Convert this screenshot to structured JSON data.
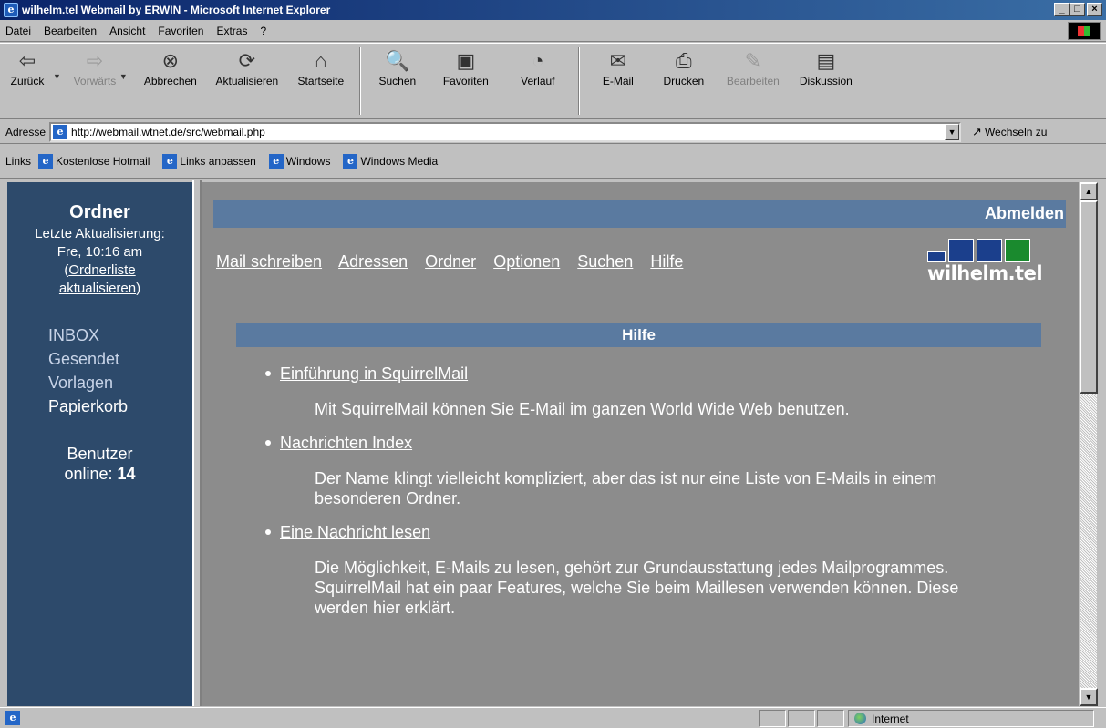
{
  "window": {
    "title": "wilhelm.tel Webmail by ERWIN - Microsoft Internet Explorer",
    "buttons": [
      "_",
      "□",
      "×"
    ]
  },
  "menu": [
    "Datei",
    "Bearbeiten",
    "Ansicht",
    "Favoriten",
    "Extras",
    "?"
  ],
  "toolbar": {
    "back": "Zurück",
    "forward": "Vorwärts",
    "stop": "Abbrechen",
    "refresh": "Aktualisieren",
    "home": "Startseite",
    "search": "Suchen",
    "favorites": "Favoriten",
    "history": "Verlauf",
    "mail": "E-Mail",
    "print": "Drucken",
    "edit": "Bearbeiten",
    "discuss": "Diskussion"
  },
  "address": {
    "label": "Adresse",
    "url": "http://webmail.wtnet.de/src/webmail.php",
    "go": "Wechseln zu"
  },
  "links": {
    "label": "Links",
    "items": [
      "Kostenlose Hotmail",
      "Links anpassen",
      "Windows",
      "Windows Media"
    ]
  },
  "left": {
    "title": "Ordner",
    "updated_label": "Letzte Aktualisierung:",
    "updated_time": "Fre, 10:16 am",
    "refresh_open": "(",
    "refresh_line1": "Ordnerliste",
    "refresh_line2": "aktualisieren",
    "refresh_close": ")",
    "folders": [
      "INBOX",
      "Gesendet",
      "Vorlagen",
      "Papierkorb"
    ],
    "users_label": "Benutzer",
    "users_online_label": "online:",
    "users_online": "14"
  },
  "right": {
    "logout": "Abmelden",
    "nav": [
      "Mail schreiben",
      "Adressen",
      "Ordner",
      "Optionen",
      "Suchen",
      "Hilfe"
    ],
    "logo_text": "wilhelm.tel",
    "help_title": "Hilfe",
    "help_items": [
      {
        "title": "Einführung in SquirrelMail",
        "desc": "Mit SquirrelMail können Sie E-Mail im ganzen World Wide Web benutzen."
      },
      {
        "title": "Nachrichten Index",
        "desc": "Der Name klingt vielleicht kompliziert, aber das ist nur eine Liste von E-Mails in einem besonderen Ordner."
      },
      {
        "title": "Eine Nachricht lesen",
        "desc": "Die Möglichkeit, E-Mails zu lesen, gehört zur Grundausstattung jedes Mailprogrammes. SquirrelMail hat ein paar Features, welche Sie beim Maillesen verwenden können. Diese werden hier erklärt."
      }
    ]
  },
  "status": {
    "zone": "Internet"
  }
}
